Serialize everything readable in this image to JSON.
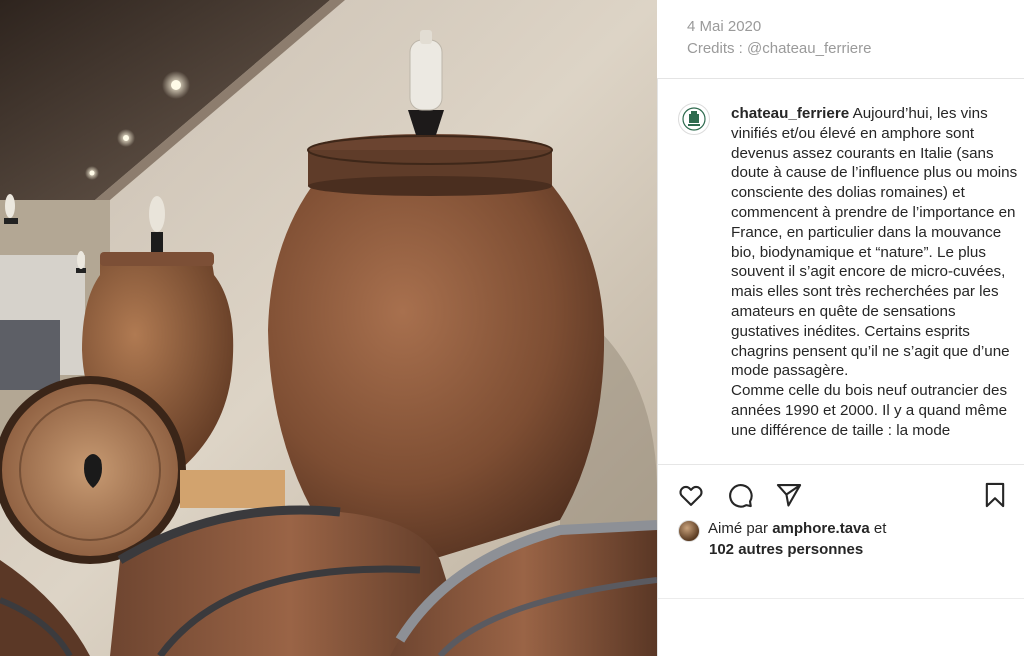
{
  "meta": {
    "date": "4 Mai 2020",
    "credits": "Credits : @chateau_ferriere"
  },
  "post": {
    "username": "chateau_ferriere",
    "caption_lines": [
      "Aujourd’hui, les vins vinifiés et/ou élevé en amphore sont devenus assez courants en Italie (sans doute à cause de l’influence plus ou moins consciente des dolias romaines) et commencent à prendre de l’importance en France, en particulier dans la mouvance bio, biodynamique et “nature”. Le plus souvent il s’agit encore de micro-cuvées, mais elles sont très recherchées par les amateurs en quête de sensations gustatives inédites. Certains esprits chagrins pensent qu’il ne s’agit que d’une mode passagère.",
      "Comme celle du bois neuf outrancier des années 1990 et 2000. Il y a quand même une différence de taille : la mode"
    ]
  },
  "actions": {
    "like": "heart-icon",
    "comment": "comment-icon",
    "share": "paper-plane-icon",
    "save": "bookmark-icon"
  },
  "likes": {
    "prefix": "Aimé par ",
    "user": "amphore.tava",
    "suffix": " et",
    "others": "102 autres personnes"
  },
  "colors": {
    "text": "#262626",
    "muted": "#9a9a9a",
    "divider": "#e6e6e6"
  }
}
